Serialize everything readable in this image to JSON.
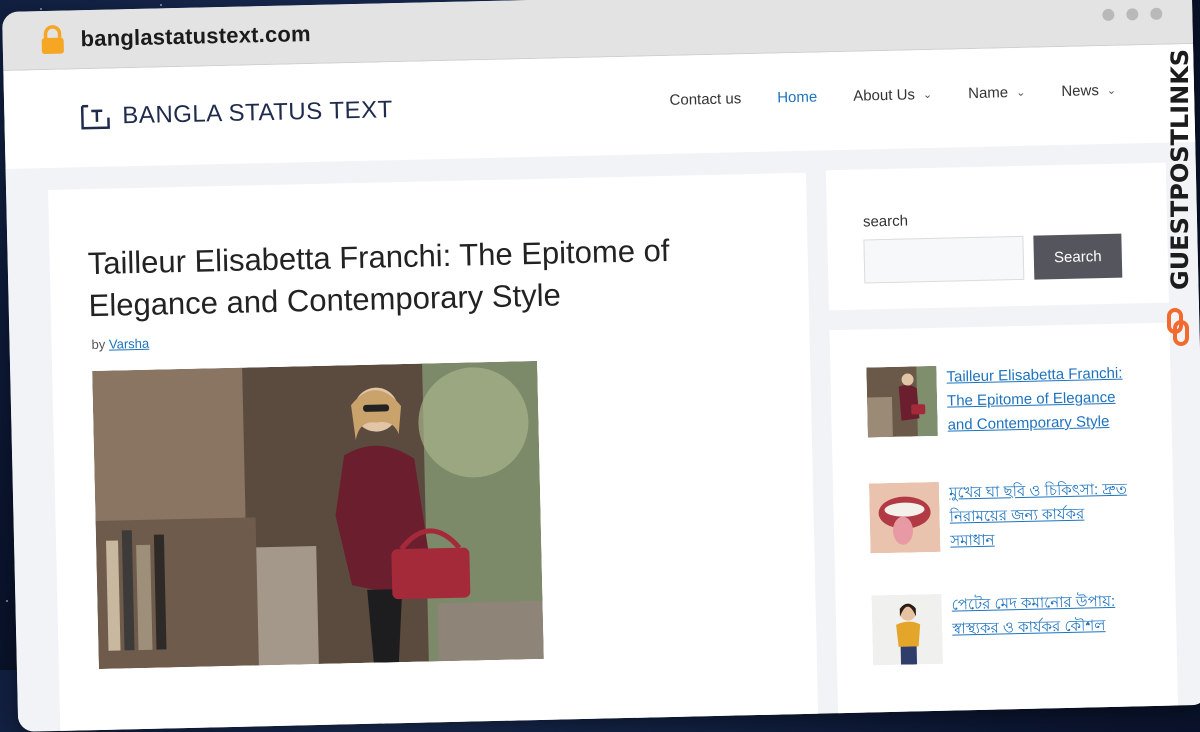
{
  "browser": {
    "url": "banglastatustext.com",
    "lock_icon": "lock-icon"
  },
  "site": {
    "logo_text": "BANGLA STATUS TEXT",
    "nav": [
      {
        "label": "Contact us",
        "has_dropdown": false
      },
      {
        "label": "Home",
        "has_dropdown": false,
        "active": true
      },
      {
        "label": "About Us",
        "has_dropdown": true
      },
      {
        "label": "Name",
        "has_dropdown": true
      },
      {
        "label": "News",
        "has_dropdown": true
      }
    ]
  },
  "article": {
    "title": "Tailleur Elisabetta Franchi: The Epitome of Elegance and Contemporary Style",
    "by_prefix": "by",
    "author": "Varsha"
  },
  "sidebar": {
    "search_label": "search",
    "search_placeholder": "",
    "search_button": "Search",
    "recent_posts": [
      {
        "title": "Tailleur Elisabetta Franchi: The Epitome of Elegance and Contemporary Style"
      },
      {
        "title": "মুখের ঘা ছবি ও চিকিৎসা: দ্রুত নিরাময়ের জন্য কার্যকর সমাধান"
      },
      {
        "title": "পেটের মেদ কমানোর উপায়: স্বাস্থ্যকর ও কার্যকর কৌশল"
      }
    ]
  },
  "watermark": {
    "text": "GUESTPOSTLINKS"
  },
  "colors": {
    "accent": "#1e73be",
    "button": "#55555e",
    "brand_orange": "#f26a2e"
  }
}
